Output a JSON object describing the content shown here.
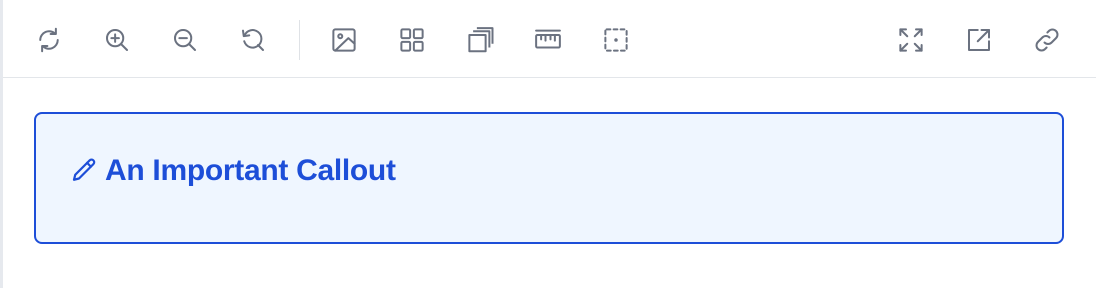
{
  "toolbar": {
    "left_icons": [
      "rotate-icon",
      "zoom-in-icon",
      "zoom-out-icon",
      "reset-icon",
      "image-icon",
      "grid-icon",
      "layers-icon",
      "ruler-icon",
      "selection-icon"
    ],
    "right_icons": [
      "fullscreen-icon",
      "external-link-icon",
      "link-icon"
    ],
    "icon_color": "#6b7280"
  },
  "callout": {
    "icon": "pencil-icon",
    "title": "An Important Callout",
    "accent_color": "#1d4ed8",
    "background_color": "#eff6ff"
  }
}
